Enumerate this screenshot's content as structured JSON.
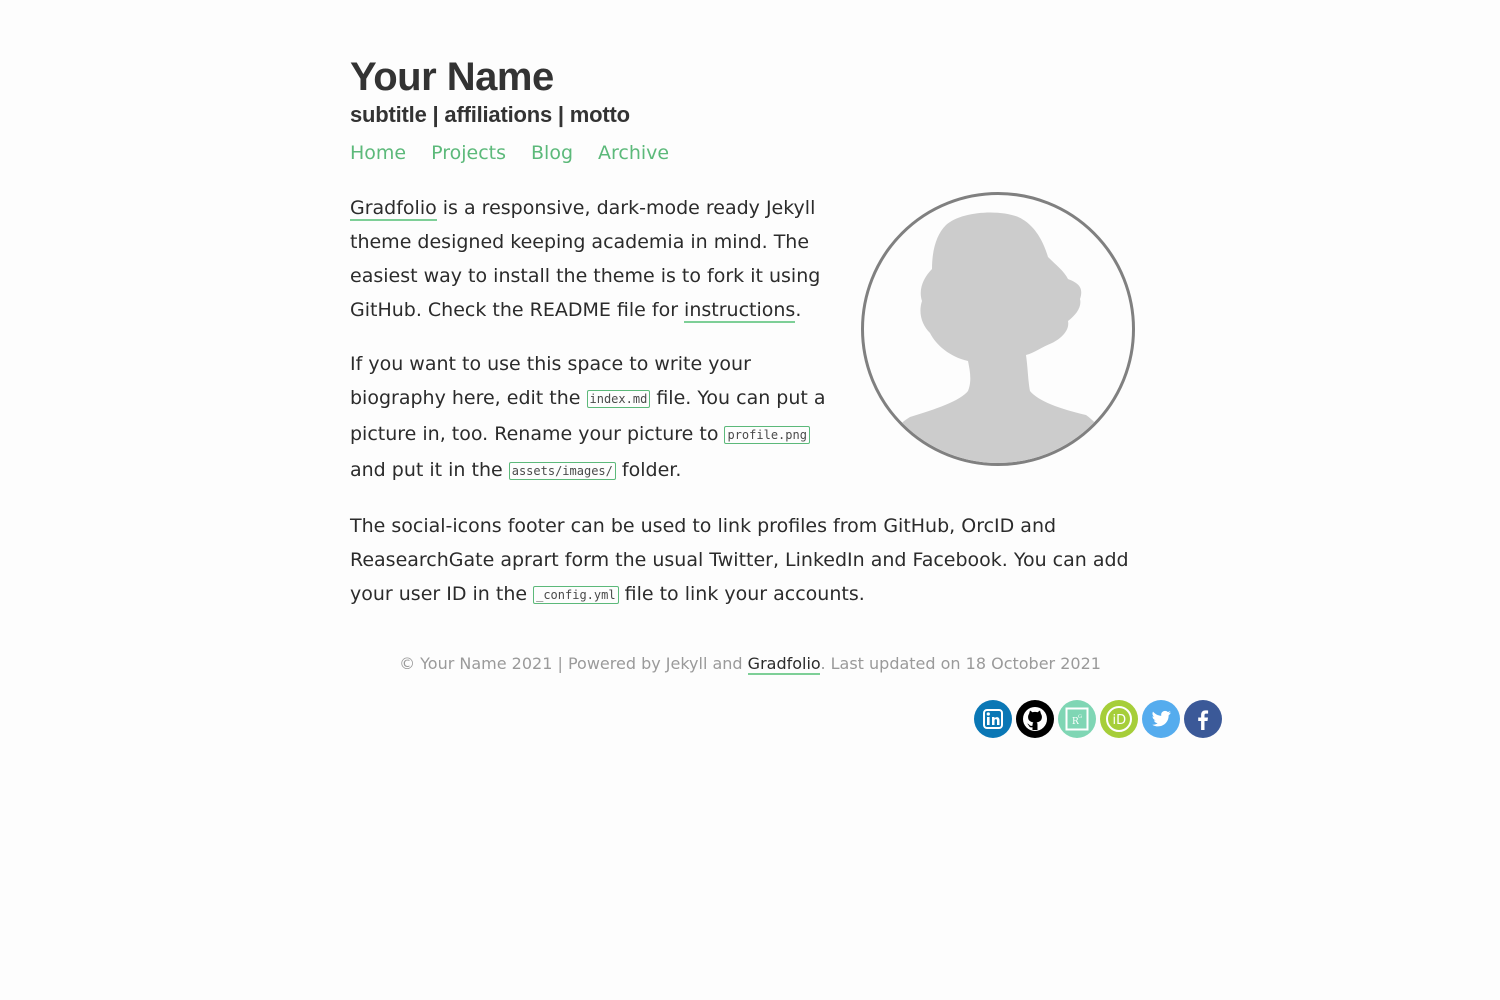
{
  "header": {
    "title": "Your Name",
    "subtitle": "subtitle | affiliations | motto"
  },
  "nav": {
    "items": [
      {
        "label": "Home"
      },
      {
        "label": "Projects"
      },
      {
        "label": "Blog"
      },
      {
        "label": "Archive"
      }
    ]
  },
  "content": {
    "p1": {
      "link1": "Gradfolio",
      "text1": " is a responsive, dark-mode ready Jekyll theme designed keeping academia in mind. The easiest way to install the theme is to fork it using GitHub. Check the README file for ",
      "link2": "instructions",
      "text2": "."
    },
    "p2": {
      "text1": "If you want to use this space to write your biography here, edit the ",
      "code1": "index.md",
      "text2": " file. You can put a picture in, too. Rename your picture to ",
      "code2": "profile.png",
      "text3": " and put it in the ",
      "code3": "assets/images/",
      "text4": " folder."
    },
    "p3": {
      "text1": "The social-icons footer can be used to link profiles from GitHub, OrcID and ReasearchGate aprart form the usual Twitter, LinkedIn and Facebook. You can add your user ID in the ",
      "code1": "_config.yml",
      "text2": " file to link your accounts."
    }
  },
  "footer": {
    "text1": "© Your Name 2021 | Powered by Jekyll and ",
    "link": "Gradfolio",
    "text2": ". Last updated on 18 October 2021"
  },
  "socials": [
    {
      "icon": "linkedin-icon",
      "color": "#0a77b5"
    },
    {
      "icon": "github-icon",
      "color": "#000000"
    },
    {
      "icon": "researchgate-icon",
      "color": "#7fd6b4"
    },
    {
      "icon": "orcid-icon",
      "color": "#a6ce39"
    },
    {
      "icon": "twitter-icon",
      "color": "#55acee"
    },
    {
      "icon": "facebook-icon",
      "color": "#3b5998"
    }
  ],
  "colors": {
    "accent": "#5cb97a",
    "background": "#fdfdfd",
    "text": "#2b2b2b"
  }
}
